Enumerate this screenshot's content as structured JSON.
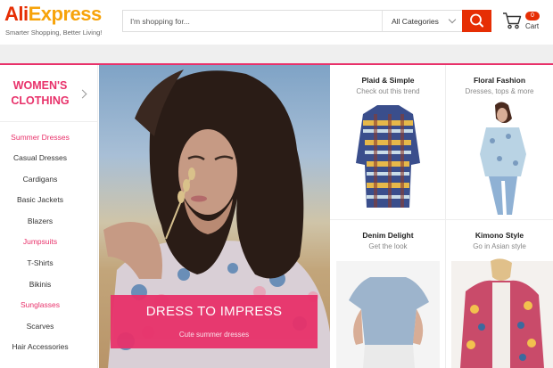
{
  "brand": {
    "name_part1": "Ali",
    "name_part2": "Express",
    "tagline": "Smarter Shopping, Better Living!",
    "primary_color": "#e62e04",
    "secondary_color": "#f7a30a"
  },
  "search": {
    "placeholder": "I'm shopping for...",
    "category": "All Categories",
    "button_icon": "search-icon"
  },
  "cart": {
    "count": "0",
    "label": "Cart",
    "icon": "cart-icon"
  },
  "sidebar": {
    "title_line1": "WOMEN'S",
    "title_line2": "CLOTHING",
    "accent_color": "#e8316a",
    "items": [
      {
        "label": "Summer Dresses",
        "highlight": true
      },
      {
        "label": "Casual Dresses",
        "highlight": false
      },
      {
        "label": "Cardigans",
        "highlight": false
      },
      {
        "label": "Basic Jackets",
        "highlight": false
      },
      {
        "label": "Blazers",
        "highlight": false
      },
      {
        "label": "Jumpsuits",
        "highlight": true
      },
      {
        "label": "T-Shirts",
        "highlight": false
      },
      {
        "label": "Bikinis",
        "highlight": false
      },
      {
        "label": "Sunglasses",
        "highlight": true
      },
      {
        "label": "Scarves",
        "highlight": false
      },
      {
        "label": "Hair Accessories",
        "highlight": false
      }
    ]
  },
  "hero": {
    "title": "DRESS TO IMPRESS",
    "subtitle": "Cute summer dresses"
  },
  "tiles": [
    {
      "title": "Plaid & Simple",
      "subtitle": "Check out this trend"
    },
    {
      "title": "Floral Fashion",
      "subtitle": "Dresses, tops & more"
    },
    {
      "title": "Denim Delight",
      "subtitle": "Get the look"
    },
    {
      "title": "Kimono Style",
      "subtitle": "Go in Asian style"
    }
  ]
}
